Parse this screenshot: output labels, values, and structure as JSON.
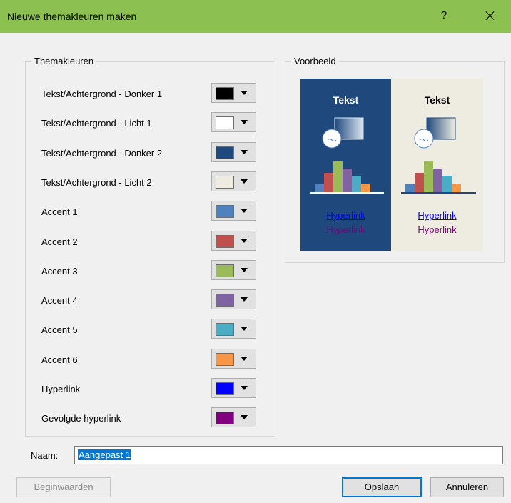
{
  "window": {
    "title": "Nieuwe themakleuren maken",
    "help_label": "?"
  },
  "theme_colors": {
    "legend": "Themakleuren",
    "rows": [
      {
        "label": "Tekst/Achtergrond - Donker 1",
        "color": "#000000"
      },
      {
        "label": "Tekst/Achtergrond - Licht 1",
        "color": "#ffffff"
      },
      {
        "label": "Tekst/Achtergrond - Donker 2",
        "color": "#1f497d"
      },
      {
        "label": "Tekst/Achtergrond - Licht 2",
        "color": "#eeece1"
      },
      {
        "label": "Accent 1",
        "color": "#4f81bd"
      },
      {
        "label": "Accent 2",
        "color": "#c0504d"
      },
      {
        "label": "Accent 3",
        "color": "#9bbb59"
      },
      {
        "label": "Accent 4",
        "color": "#8064a2"
      },
      {
        "label": "Accent 5",
        "color": "#4bacc6"
      },
      {
        "label": "Accent 6",
        "color": "#f79646"
      },
      {
        "label": "Hyperlink",
        "color": "#0000ff"
      },
      {
        "label": "Gevolgde hyperlink",
        "color": "#800080"
      }
    ]
  },
  "preview": {
    "legend": "Voorbeeld",
    "dark": {
      "title": "Tekst",
      "hyperlink": "Hyperlink",
      "followed": "Hyperlink"
    },
    "light": {
      "title": "Tekst",
      "hyperlink": "Hyperlink",
      "followed": "Hyperlink"
    }
  },
  "name": {
    "label": "Naam:",
    "value": "Aangepast 1"
  },
  "buttons": {
    "reset": "Beginwaarden",
    "save": "Opslaan",
    "cancel": "Annuleren"
  }
}
